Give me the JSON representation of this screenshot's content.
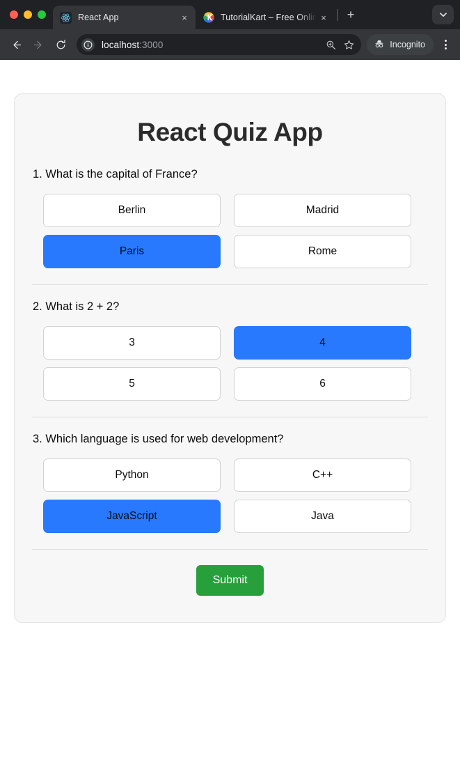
{
  "browser": {
    "window_controls": [
      "close",
      "minimize",
      "maximize"
    ],
    "tabs": [
      {
        "title": "React App",
        "favicon": "react-logo-icon",
        "active": true,
        "close_label": "×"
      },
      {
        "title": "TutorialKart – Free Online C",
        "favicon": "tutorialkart-logo-icon",
        "active": false,
        "close_label": "×"
      }
    ],
    "new_tab_label": "+",
    "tab_list_chevron": "⌄",
    "toolbar": {
      "back_label": "←",
      "forward_label": "→",
      "reload_label": "↻",
      "site_info_label": "i",
      "url_host": "localhost",
      "url_port": ":3000",
      "url_full": "localhost:3000",
      "zoom_label": "⌕",
      "bookmark_label": "☆",
      "incognito_label": "Incognito",
      "menu_label": "⋮"
    }
  },
  "quiz": {
    "title": "React Quiz App",
    "submit_label": "Submit",
    "selected_color": "#2979ff",
    "submit_color": "#27a03c",
    "questions": [
      {
        "text": "1. What is the capital of France?",
        "options": [
          {
            "label": "Berlin",
            "selected": false
          },
          {
            "label": "Madrid",
            "selected": false
          },
          {
            "label": "Paris",
            "selected": true
          },
          {
            "label": "Rome",
            "selected": false
          }
        ]
      },
      {
        "text": "2. What is 2 + 2?",
        "options": [
          {
            "label": "3",
            "selected": false
          },
          {
            "label": "4",
            "selected": true
          },
          {
            "label": "5",
            "selected": false
          },
          {
            "label": "6",
            "selected": false
          }
        ]
      },
      {
        "text": "3. Which language is used for web development?",
        "options": [
          {
            "label": "Python",
            "selected": false
          },
          {
            "label": "C++",
            "selected": false
          },
          {
            "label": "JavaScript",
            "selected": true
          },
          {
            "label": "Java",
            "selected": false
          }
        ]
      }
    ]
  }
}
